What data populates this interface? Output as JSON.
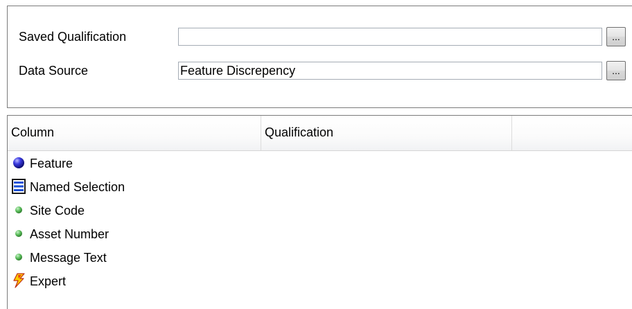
{
  "form": {
    "saved_qualification_label": "Saved Qualification",
    "saved_qualification_value": "",
    "data_source_label": "Data Source",
    "data_source_value": "Feature Discrepency",
    "browse_label": "..."
  },
  "grid": {
    "columns": [
      "Column",
      "Qualification",
      ""
    ],
    "items": [
      {
        "label": "Feature",
        "icon": "blue-sphere-icon"
      },
      {
        "label": "Named Selection",
        "icon": "named-selection-icon"
      },
      {
        "label": "Site Code",
        "icon": "green-dot-icon"
      },
      {
        "label": "Asset Number",
        "icon": "green-dot-icon"
      },
      {
        "label": "Message Text",
        "icon": "green-dot-icon"
      },
      {
        "label": "Expert",
        "icon": "lightning-icon"
      }
    ]
  },
  "colors": {
    "panel_border": "#7a7a7a",
    "input_border": "#a5acb5",
    "sphere_blue": "#1f1fb8",
    "dot_green": "#5cbf5c"
  }
}
